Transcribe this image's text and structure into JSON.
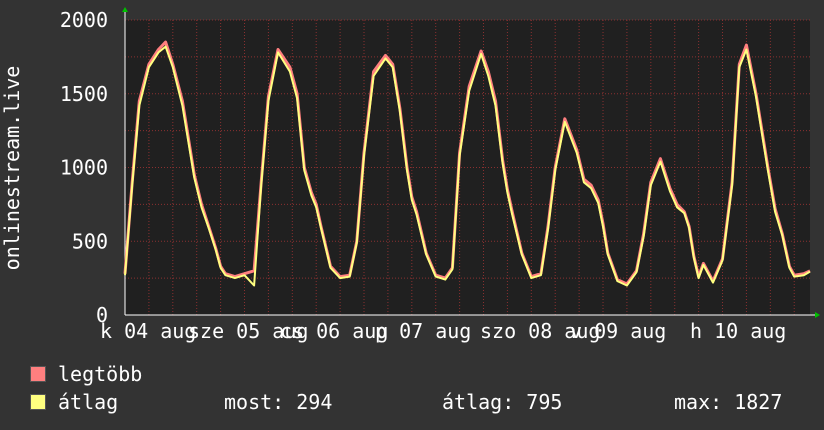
{
  "chart_data": {
    "type": "line",
    "ylabel": "onlinestream.live",
    "ylim": [
      0,
      2000
    ],
    "y_ticks": [
      "0",
      "500",
      "1000",
      "1500",
      "2000"
    ],
    "x_ticks": [
      "k 04 aug",
      "sze 05 aug",
      "cs 06 aug",
      "p 07 aug",
      "szo 08 aug",
      "v 09 aug",
      "h 10 aug"
    ],
    "grid": true,
    "colors": {
      "background": "#333333",
      "plot_area": "#202020",
      "grid": "#8a3030",
      "max_series": "#ff7f7f",
      "avg_series": "#ffff80",
      "axis_arrow": "#00c000"
    },
    "series": [
      {
        "name": "legtöbb",
        "color": "#ff7f7f",
        "x": [
          0.0,
          0.15,
          0.3,
          0.5,
          0.7,
          0.85,
          1.0,
          1.2,
          1.45,
          1.6,
          1.75,
          1.9,
          2.0,
          2.1,
          2.3,
          2.5,
          2.7,
          2.85,
          3.0,
          3.2,
          3.45,
          3.6,
          3.75,
          3.9,
          4.0,
          4.1,
          4.3,
          4.5,
          4.7,
          4.85,
          5.0,
          5.2,
          5.45,
          5.6,
          5.75,
          5.9,
          6.0,
          6.1,
          6.3,
          6.5,
          6.7,
          6.85,
          7.0,
          7.2,
          7.45,
          7.6,
          7.75,
          7.9,
          8.0,
          8.1,
          8.3,
          8.5,
          8.7,
          8.85,
          9.0,
          9.2,
          9.45,
          9.6,
          9.75,
          9.9,
          10.0,
          10.1,
          10.3,
          10.5,
          10.7,
          10.85,
          11.0,
          11.2,
          11.4,
          11.55,
          11.7,
          11.8,
          11.9,
          12.0,
          12.1,
          12.3,
          12.5,
          12.7,
          12.85,
          13.0,
          13.2,
          13.45,
          13.6,
          13.75,
          13.9,
          14.0,
          14.2,
          14.33
        ],
        "y": [
          280,
          900,
          1450,
          1700,
          1800,
          1850,
          1700,
          1450,
          950,
          750,
          600,
          450,
          330,
          280,
          260,
          280,
          300,
          900,
          1480,
          1800,
          1680,
          1500,
          1000,
          830,
          750,
          600,
          330,
          260,
          270,
          500,
          1100,
          1650,
          1760,
          1700,
          1400,
          1000,
          800,
          700,
          420,
          270,
          250,
          320,
          1100,
          1550,
          1790,
          1650,
          1450,
          1050,
          850,
          700,
          420,
          260,
          280,
          600,
          1000,
          1330,
          1120,
          920,
          880,
          780,
          620,
          420,
          240,
          210,
          300,
          550,
          900,
          1060,
          860,
          750,
          700,
          600,
          400,
          260,
          350,
          230,
          380,
          900,
          1700,
          1830,
          1500,
          1000,
          720,
          550,
          330,
          270,
          280,
          300
        ]
      },
      {
        "name": "átlag",
        "color": "#ffff80",
        "x": [
          0.0,
          0.15,
          0.3,
          0.5,
          0.7,
          0.85,
          1.0,
          1.2,
          1.45,
          1.6,
          1.75,
          1.9,
          2.0,
          2.1,
          2.3,
          2.5,
          2.7,
          2.85,
          3.0,
          3.2,
          3.45,
          3.6,
          3.75,
          3.9,
          4.0,
          4.1,
          4.3,
          4.5,
          4.7,
          4.85,
          5.0,
          5.2,
          5.45,
          5.6,
          5.75,
          5.9,
          6.0,
          6.1,
          6.3,
          6.5,
          6.7,
          6.85,
          7.0,
          7.2,
          7.45,
          7.6,
          7.75,
          7.9,
          8.0,
          8.1,
          8.3,
          8.5,
          8.7,
          8.85,
          9.0,
          9.2,
          9.45,
          9.6,
          9.75,
          9.9,
          10.0,
          10.1,
          10.3,
          10.5,
          10.7,
          10.85,
          11.0,
          11.2,
          11.4,
          11.55,
          11.7,
          11.8,
          11.9,
          12.0,
          12.1,
          12.3,
          12.5,
          12.7,
          12.85,
          13.0,
          13.2,
          13.45,
          13.6,
          13.75,
          13.9,
          14.0,
          14.2,
          14.33
        ],
        "y": [
          270,
          880,
          1420,
          1680,
          1780,
          1820,
          1680,
          1420,
          930,
          730,
          590,
          440,
          320,
          270,
          250,
          270,
          200,
          880,
          1450,
          1780,
          1650,
          1470,
          980,
          810,
          730,
          590,
          320,
          250,
          260,
          490,
          1080,
          1620,
          1740,
          1680,
          1380,
          980,
          780,
          680,
          410,
          260,
          240,
          310,
          1080,
          1520,
          1770,
          1620,
          1420,
          1030,
          830,
          680,
          410,
          250,
          270,
          580,
          980,
          1310,
          1100,
          900,
          860,
          760,
          600,
          410,
          230,
          200,
          290,
          530,
          880,
          1040,
          840,
          730,
          690,
          590,
          390,
          250,
          340,
          220,
          370,
          880,
          1680,
          1800,
          1480,
          980,
          700,
          540,
          320,
          260,
          270,
          294
        ]
      }
    ]
  },
  "legend": {
    "max_label": "legtöbb",
    "avg_label": "átlag"
  },
  "stats": {
    "now": "most: 294",
    "avg": "átlag: 795",
    "max": "max: 1827"
  }
}
